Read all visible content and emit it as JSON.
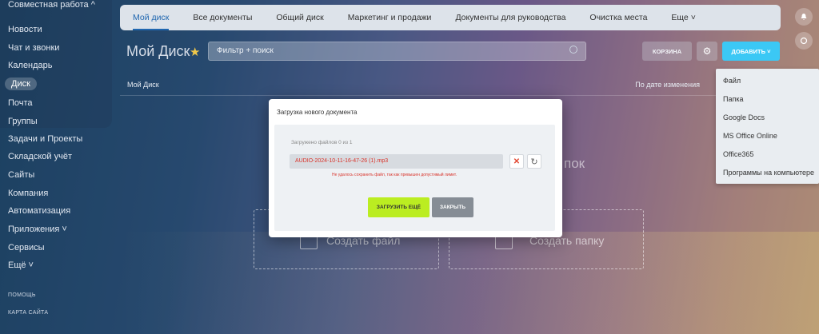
{
  "sidebar": {
    "items": [
      {
        "label": "Совместная работа ^"
      },
      {
        "label": "Новости"
      },
      {
        "label": "Чат и звонки"
      },
      {
        "label": "Календарь"
      },
      {
        "label": "Диск"
      },
      {
        "label": "Почта"
      },
      {
        "label": "Группы"
      },
      {
        "label": "Задачи и Проекты"
      },
      {
        "label": "Складской учёт"
      },
      {
        "label": "Сайты"
      },
      {
        "label": "Компания"
      },
      {
        "label": "Автоматизация"
      },
      {
        "label": "Приложения ˅"
      },
      {
        "label": "Сервисы"
      },
      {
        "label": "Ещё ˅"
      }
    ],
    "help_label": "ПОМОЩЬ",
    "sitemap_label": "КАРТА САЙТА"
  },
  "tabs": [
    {
      "label": "Мой диск"
    },
    {
      "label": "Все документы"
    },
    {
      "label": "Общий диск"
    },
    {
      "label": "Маркетинг и продажи"
    },
    {
      "label": "Документы для руководства"
    },
    {
      "label": "Очистка места"
    },
    {
      "label": "Еще ˅"
    }
  ],
  "header": {
    "title": "Мой Диск",
    "filter_placeholder": "Фильтр + поиск",
    "trash_label": "КОРЗИНА",
    "add_label": "ДОБАВИТЬ ˅"
  },
  "breadcrumb": {
    "current": "Мой Диск",
    "sort_label": "По дате изменения"
  },
  "add_menu": {
    "items": [
      "Файл",
      "Папка",
      "Google Docs",
      "MS Office Online",
      "Office365",
      "Программы на компьютере"
    ]
  },
  "empty_state": {
    "text_fragment": "пок",
    "create_file": "Создать файл",
    "create_folder": "Создать папку"
  },
  "modal": {
    "title": "Загрузка нового документа",
    "counter": "Загружено файлов 0 из 1",
    "file_name": "AUDIO-2024-10-11-16-47-26 (1).mp3",
    "error": "Не удалось сохранить файл, так как превышен допустимый лимит.",
    "upload_more_label": "ЗАГРУЗИТЬ ЕЩЁ",
    "close_label": "ЗАКРЫТЬ"
  },
  "colors": {
    "accent_blue": "#2067b0",
    "add_button": "#3bc8f5",
    "upload_button": "#bbed21",
    "error_red": "#d9342b"
  },
  "icons": [
    "star-icon",
    "search-icon",
    "gear-icon",
    "bell-icon",
    "chat-icon",
    "close-icon",
    "retry-icon",
    "file-icon",
    "folder-icon"
  ]
}
